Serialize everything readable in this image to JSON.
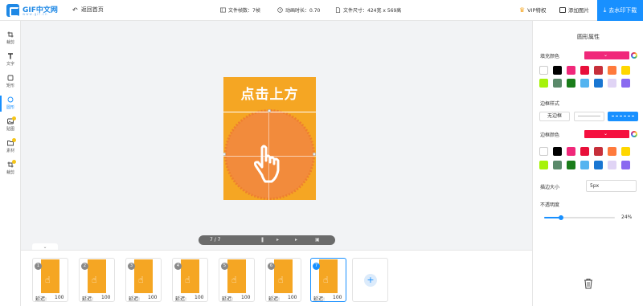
{
  "header": {
    "logo_text": "GIF中文网",
    "logo_sub": "www.gif.cn",
    "back_label": "返回首页",
    "frame_count": "文件帧数：7帧",
    "duration": "动画时长：0.70",
    "file_size": "文件尺寸：424宽 x 569高",
    "vip_label": "VIP特权",
    "add_image_label": "添加图片",
    "download_label": "去水印下载"
  },
  "toolbar": {
    "items": [
      {
        "label": "裁剪",
        "icon": "crop-icon"
      },
      {
        "label": "文字",
        "icon": "text-icon"
      },
      {
        "label": "矩形",
        "icon": "rectangle-icon"
      },
      {
        "label": "圆形",
        "icon": "circle-icon"
      },
      {
        "label": "贴图",
        "icon": "image-icon"
      },
      {
        "label": "素材",
        "icon": "folder-icon"
      },
      {
        "label": "裁剪",
        "icon": "crop-icon"
      }
    ]
  },
  "canvas": {
    "banner_text": "点击上方",
    "playbar_pages": "7 / 7"
  },
  "frames": {
    "delay_label": "延迟:",
    "items": [
      {
        "num": "1",
        "delay": "100"
      },
      {
        "num": "2",
        "delay": "100"
      },
      {
        "num": "3",
        "delay": "100"
      },
      {
        "num": "4",
        "delay": "100"
      },
      {
        "num": "5",
        "delay": "100"
      },
      {
        "num": "6",
        "delay": "100"
      },
      {
        "num": "7",
        "delay": "100",
        "selected": true
      }
    ],
    "add_label": "+"
  },
  "panel": {
    "title": "圆形属性",
    "fill_label": "填充颜色",
    "fill_color": "#f0287a",
    "border_style_label": "边框样式",
    "no_border_label": "无边框",
    "border_color_label": "边框颜色",
    "border_color": "#f5103f",
    "stroke_label": "描边大小",
    "stroke_value": "5px",
    "opacity_label": "不透明度",
    "opacity_value": "24%",
    "opacity_fraction": 0.24,
    "swatches": [
      "#ffffff",
      "#000000",
      "#f0287a",
      "#e8103a",
      "#c62f3a",
      "#ff7a3c",
      "#ffd700",
      "#a6f20a",
      "#5a8a6a",
      "#1a7d1a",
      "#54b4f0",
      "#1976d2",
      "#e0d4f5",
      "#8a6af0"
    ]
  },
  "colors": {
    "accent": "#1890ff",
    "artboard": "#f5a623",
    "circle": "#f28b3c"
  }
}
